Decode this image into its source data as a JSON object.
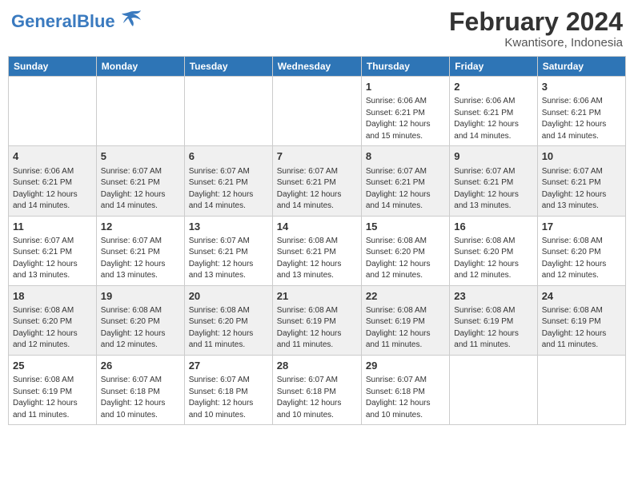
{
  "logo": {
    "part1": "General",
    "part2": "Blue"
  },
  "title": "February 2024",
  "subtitle": "Kwantisore, Indonesia",
  "days_of_week": [
    "Sunday",
    "Monday",
    "Tuesday",
    "Wednesday",
    "Thursday",
    "Friday",
    "Saturday"
  ],
  "weeks": [
    [
      {
        "day": "",
        "info": ""
      },
      {
        "day": "",
        "info": ""
      },
      {
        "day": "",
        "info": ""
      },
      {
        "day": "",
        "info": ""
      },
      {
        "day": "1",
        "info": "Sunrise: 6:06 AM\nSunset: 6:21 PM\nDaylight: 12 hours\nand 15 minutes."
      },
      {
        "day": "2",
        "info": "Sunrise: 6:06 AM\nSunset: 6:21 PM\nDaylight: 12 hours\nand 14 minutes."
      },
      {
        "day": "3",
        "info": "Sunrise: 6:06 AM\nSunset: 6:21 PM\nDaylight: 12 hours\nand 14 minutes."
      }
    ],
    [
      {
        "day": "4",
        "info": "Sunrise: 6:06 AM\nSunset: 6:21 PM\nDaylight: 12 hours\nand 14 minutes."
      },
      {
        "day": "5",
        "info": "Sunrise: 6:07 AM\nSunset: 6:21 PM\nDaylight: 12 hours\nand 14 minutes."
      },
      {
        "day": "6",
        "info": "Sunrise: 6:07 AM\nSunset: 6:21 PM\nDaylight: 12 hours\nand 14 minutes."
      },
      {
        "day": "7",
        "info": "Sunrise: 6:07 AM\nSunset: 6:21 PM\nDaylight: 12 hours\nand 14 minutes."
      },
      {
        "day": "8",
        "info": "Sunrise: 6:07 AM\nSunset: 6:21 PM\nDaylight: 12 hours\nand 14 minutes."
      },
      {
        "day": "9",
        "info": "Sunrise: 6:07 AM\nSunset: 6:21 PM\nDaylight: 12 hours\nand 13 minutes."
      },
      {
        "day": "10",
        "info": "Sunrise: 6:07 AM\nSunset: 6:21 PM\nDaylight: 12 hours\nand 13 minutes."
      }
    ],
    [
      {
        "day": "11",
        "info": "Sunrise: 6:07 AM\nSunset: 6:21 PM\nDaylight: 12 hours\nand 13 minutes."
      },
      {
        "day": "12",
        "info": "Sunrise: 6:07 AM\nSunset: 6:21 PM\nDaylight: 12 hours\nand 13 minutes."
      },
      {
        "day": "13",
        "info": "Sunrise: 6:07 AM\nSunset: 6:21 PM\nDaylight: 12 hours\nand 13 minutes."
      },
      {
        "day": "14",
        "info": "Sunrise: 6:08 AM\nSunset: 6:21 PM\nDaylight: 12 hours\nand 13 minutes."
      },
      {
        "day": "15",
        "info": "Sunrise: 6:08 AM\nSunset: 6:20 PM\nDaylight: 12 hours\nand 12 minutes."
      },
      {
        "day": "16",
        "info": "Sunrise: 6:08 AM\nSunset: 6:20 PM\nDaylight: 12 hours\nand 12 minutes."
      },
      {
        "day": "17",
        "info": "Sunrise: 6:08 AM\nSunset: 6:20 PM\nDaylight: 12 hours\nand 12 minutes."
      }
    ],
    [
      {
        "day": "18",
        "info": "Sunrise: 6:08 AM\nSunset: 6:20 PM\nDaylight: 12 hours\nand 12 minutes."
      },
      {
        "day": "19",
        "info": "Sunrise: 6:08 AM\nSunset: 6:20 PM\nDaylight: 12 hours\nand 12 minutes."
      },
      {
        "day": "20",
        "info": "Sunrise: 6:08 AM\nSunset: 6:20 PM\nDaylight: 12 hours\nand 11 minutes."
      },
      {
        "day": "21",
        "info": "Sunrise: 6:08 AM\nSunset: 6:19 PM\nDaylight: 12 hours\nand 11 minutes."
      },
      {
        "day": "22",
        "info": "Sunrise: 6:08 AM\nSunset: 6:19 PM\nDaylight: 12 hours\nand 11 minutes."
      },
      {
        "day": "23",
        "info": "Sunrise: 6:08 AM\nSunset: 6:19 PM\nDaylight: 12 hours\nand 11 minutes."
      },
      {
        "day": "24",
        "info": "Sunrise: 6:08 AM\nSunset: 6:19 PM\nDaylight: 12 hours\nand 11 minutes."
      }
    ],
    [
      {
        "day": "25",
        "info": "Sunrise: 6:08 AM\nSunset: 6:19 PM\nDaylight: 12 hours\nand 11 minutes."
      },
      {
        "day": "26",
        "info": "Sunrise: 6:07 AM\nSunset: 6:18 PM\nDaylight: 12 hours\nand 10 minutes."
      },
      {
        "day": "27",
        "info": "Sunrise: 6:07 AM\nSunset: 6:18 PM\nDaylight: 12 hours\nand 10 minutes."
      },
      {
        "day": "28",
        "info": "Sunrise: 6:07 AM\nSunset: 6:18 PM\nDaylight: 12 hours\nand 10 minutes."
      },
      {
        "day": "29",
        "info": "Sunrise: 6:07 AM\nSunset: 6:18 PM\nDaylight: 12 hours\nand 10 minutes."
      },
      {
        "day": "",
        "info": ""
      },
      {
        "day": "",
        "info": ""
      }
    ]
  ]
}
